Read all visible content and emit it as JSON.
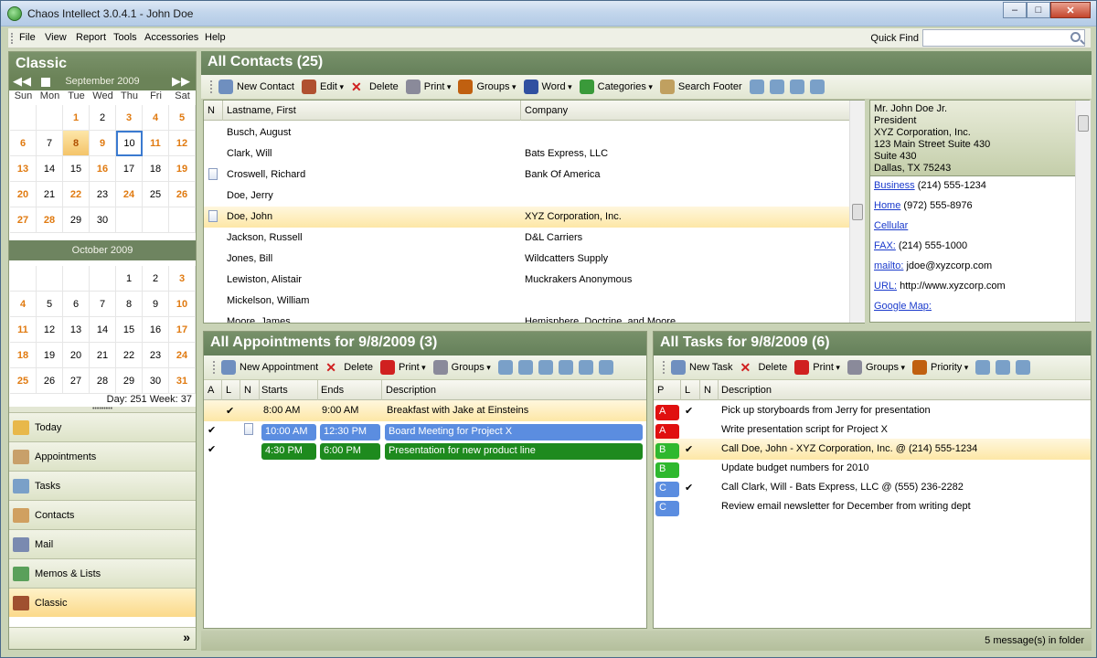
{
  "window": {
    "title": "Chaos Intellect 3.0.4.1 - John Doe",
    "min": "–",
    "max": "□",
    "close": "✕"
  },
  "menu": [
    "File",
    "View",
    "Report",
    "Tools",
    "Accessories",
    "Help"
  ],
  "quick_find": {
    "label": "Quick Find",
    "value": ""
  },
  "left": {
    "title": "Classic",
    "cal1": {
      "month": "September 2009",
      "dow": [
        "Sun",
        "Mon",
        "Tue",
        "Wed",
        "Thu",
        "Fri",
        "Sat"
      ],
      "weeks": [
        [
          "",
          "",
          "1",
          "2",
          "3",
          "4",
          "5"
        ],
        [
          "6",
          "7",
          "8",
          "9",
          "10",
          "11",
          "12"
        ],
        [
          "13",
          "14",
          "15",
          "16",
          "17",
          "18",
          "19"
        ],
        [
          "20",
          "21",
          "22",
          "23",
          "24",
          "25",
          "26"
        ],
        [
          "27",
          "28",
          "29",
          "30",
          "",
          "",
          ""
        ]
      ]
    },
    "cal2": {
      "month": "October 2009",
      "weeks": [
        [
          "",
          "",
          "",
          "",
          "1",
          "2",
          "3"
        ],
        [
          "4",
          "5",
          "6",
          "7",
          "8",
          "9",
          "10"
        ],
        [
          "11",
          "12",
          "13",
          "14",
          "15",
          "16",
          "17"
        ],
        [
          "18",
          "19",
          "20",
          "21",
          "22",
          "23",
          "24"
        ],
        [
          "25",
          "26",
          "27",
          "28",
          "29",
          "30",
          "31"
        ]
      ]
    },
    "footer": "Day: 251  Week: 37",
    "nav": [
      {
        "label": "Today",
        "icon": "today-icon"
      },
      {
        "label": "Appointments",
        "icon": "appointments-icon"
      },
      {
        "label": "Tasks",
        "icon": "tasks-icon"
      },
      {
        "label": "Contacts",
        "icon": "contacts-icon"
      },
      {
        "label": "Mail",
        "icon": "mail-icon"
      },
      {
        "label": "Memos & Lists",
        "icon": "memos-icon"
      },
      {
        "label": "Classic",
        "icon": "classic-icon"
      }
    ],
    "more": "»"
  },
  "contacts": {
    "title": "All Contacts (25)",
    "toolbar": [
      "New Contact",
      "Edit",
      "Delete",
      "Print",
      "Groups",
      "Word",
      "Categories",
      "Search Footer"
    ],
    "cols": [
      "N",
      "Lastname, First",
      "Company"
    ],
    "rows": [
      {
        "name": "Busch, August",
        "company": "",
        "note": false
      },
      {
        "name": "Clark, Will",
        "company": "Bats Express, LLC",
        "note": false
      },
      {
        "name": "Croswell, Richard",
        "company": "Bank Of America",
        "note": true
      },
      {
        "name": "Doe, Jerry",
        "company": "",
        "note": false
      },
      {
        "name": "Doe, John",
        "company": "XYZ Corporation, Inc.",
        "note": true,
        "sel": true
      },
      {
        "name": "Jackson, Russell",
        "company": "D&L  Carriers",
        "note": false
      },
      {
        "name": "Jones, Bill",
        "company": "Wildcatters Supply",
        "note": false
      },
      {
        "name": "Lewiston, Alistair",
        "company": "Muckrakers Anonymous",
        "note": false
      },
      {
        "name": "Mickelson, William",
        "company": "",
        "note": false
      },
      {
        "name": "Moore, James",
        "company": "Hemisphere, Doctrine, and Moore",
        "note": false
      }
    ]
  },
  "card": {
    "top": [
      "Mr. John Doe Jr.",
      "President",
      "XYZ Corporation, Inc.",
      "123 Main Street Suite 430",
      "Suite 430",
      "Dallas, TX 75243"
    ],
    "lines": [
      {
        "link": "Business",
        "text": " (214) 555-1234"
      },
      {
        "link": "Home",
        "text": " (972) 555-8976"
      },
      {
        "link": "Cellular",
        "text": ""
      },
      {
        "link": "FAX:",
        "text": " (214) 555-1000"
      },
      {
        "link": "mailto:",
        "text": " jdoe@xyzcorp.com"
      },
      {
        "link": "URL:",
        "text": " http://www.xyzcorp.com"
      },
      {
        "link": "Google Map:",
        "text": ""
      }
    ]
  },
  "appointments": {
    "title": "All Appointments for 9/8/2009 (3)",
    "toolbar": [
      "New Appointment",
      "Delete",
      "Print",
      "Groups"
    ],
    "cols": [
      "A",
      "L",
      "N",
      "Starts",
      "Ends",
      "Description"
    ],
    "rows": [
      {
        "a": "",
        "l": "✔",
        "n": false,
        "start": "8:00 AM",
        "end": "9:00 AM",
        "desc": "Breakfast with Jake at Einsteins",
        "color": "",
        "sel": true
      },
      {
        "a": "✔",
        "l": "",
        "n": true,
        "start": "10:00 AM",
        "end": "12:30 PM",
        "desc": "Board Meeting for Project X",
        "color": "#5b8de0"
      },
      {
        "a": "✔",
        "l": "",
        "n": false,
        "start": "4:30 PM",
        "end": "6:00 PM",
        "desc": "Presentation for new product line",
        "color": "#1e8a1e"
      }
    ]
  },
  "tasks": {
    "title": "All Tasks for 9/8/2009 (6)",
    "toolbar": [
      "New Task",
      "Delete",
      "Print",
      "Groups",
      "Priority"
    ],
    "cols": [
      "P",
      "L",
      "N",
      "Description"
    ],
    "rows": [
      {
        "p": "A",
        "pc": "#e01010",
        "l": "✔",
        "desc": "Pick up storyboards from Jerry for presentation"
      },
      {
        "p": "A",
        "pc": "#e01010",
        "l": "",
        "desc": "Write presentation script for Project X"
      },
      {
        "p": "B",
        "pc": "#2eb82e",
        "l": "✔",
        "desc": "Call Doe, John - XYZ Corporation, Inc. @ (214) 555-1234",
        "sel": true
      },
      {
        "p": "B",
        "pc": "#2eb82e",
        "l": "",
        "desc": "Update budget numbers for 2010"
      },
      {
        "p": "C",
        "pc": "#5b8de0",
        "l": "✔",
        "desc": "Call Clark, Will - Bats Express, LLC @ (555) 236-2282"
      },
      {
        "p": "C",
        "pc": "#5b8de0",
        "l": "",
        "desc": "Review email newsletter for December from writing dept"
      }
    ]
  },
  "status": "5 message(s) in folder"
}
